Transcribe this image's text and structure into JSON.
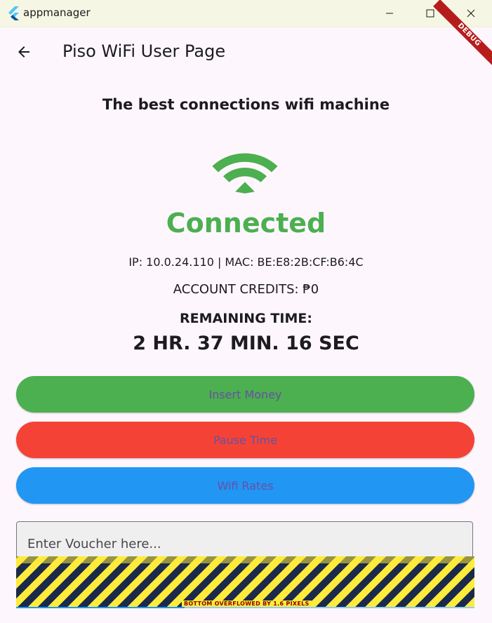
{
  "window": {
    "title": "appmanager",
    "controls": [
      "minimize",
      "maximize",
      "close"
    ]
  },
  "appbar": {
    "title": "Piso WiFi User Page",
    "back_icon": "arrow-back-icon"
  },
  "debug_banner": "DEBUG",
  "main": {
    "subtitle": "The best connections wifi machine",
    "wifi_icon": "wifi-icon",
    "status": "Connected",
    "network_info": "IP: 10.0.24.110 | MAC: BE:E8:2B:CF:B6:4C",
    "credits": "ACCOUNT CREDITS: ₱0",
    "remaining_label": "REMAINING TIME:",
    "remaining_value": "2 HR. 37 MIN. 16 SEC"
  },
  "buttons": {
    "insert_money": "Insert Money",
    "pause_time": "Pause Time",
    "wifi_rates": "Wifi Rates"
  },
  "voucher": {
    "placeholder": "Enter Voucher here..."
  },
  "overflow_warning": "BOTTOM OVERFLOWED BY 1.6 PIXELS",
  "colors": {
    "connected": "#4caf50",
    "insert_money": "#4caf50",
    "pause_time": "#f44336",
    "wifi_rates": "#2196f3",
    "button_text": "#6750a4",
    "debug": "#b71c1c"
  }
}
